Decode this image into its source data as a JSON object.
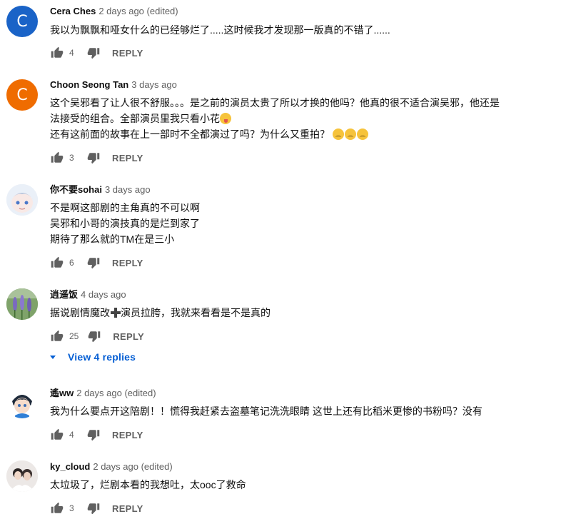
{
  "colors": {
    "link_blue": "#065fd4",
    "secondary_text": "#606060",
    "avatar_c_blue": "#1a63c7",
    "avatar_c_orange": "#ef6c00"
  },
  "comments": [
    {
      "author": "Cera Ches",
      "time": "2 days ago (edited)",
      "lines": [
        "我以为飘飘和哑女什么的已经够烂了.....这时候我才发现那一版真的不错了......"
      ],
      "likes": "4",
      "reply_label": "REPLY",
      "avatar": {
        "type": "letter",
        "letter": "C",
        "color": "#1a63c7"
      }
    },
    {
      "author": "Choon Seong Tan",
      "time": "3 days ago",
      "lines": [
        "这个吴邪看了让人很不舒服。。。是之前的演员太贵了所以才换的他吗？他真的很不适合演吴邪，他还是",
        "法接受的组合。全部演员里我只看小花",
        "还有这前面的故事在上一部时不全都演过了吗？为什么又重拍？"
      ],
      "likes": "3",
      "reply_label": "REPLY",
      "avatar": {
        "type": "letter",
        "letter": "C",
        "color": "#ef6c00"
      },
      "emojis": {
        "line2": [
          "face-with-tongue-emoji"
        ],
        "line3": [
          "sad-face-emoji",
          "sad-face-emoji",
          "sad-face-emoji"
        ]
      }
    },
    {
      "author": "你不要sohai",
      "time": "3 days ago",
      "lines": [
        "不是啊这部剧的主角真的不可以啊",
        "吴邪和小哥的演技真的是烂到家了",
        "期待了那么就的TM在是三小"
      ],
      "likes": "6",
      "reply_label": "REPLY",
      "avatar": {
        "type": "image",
        "desc": "anime-avatar"
      }
    },
    {
      "author": "逍遥饭",
      "time": "4 days ago",
      "lines_parts": [
        "据说剧情魔改",
        "演员拉胯，我就来看看是不是真的"
      ],
      "likes": "25",
      "reply_label": "REPLY",
      "view_replies": "View 4 replies",
      "avatar": {
        "type": "image",
        "desc": "lavender-avatar"
      }
    },
    {
      "author": "遙ww",
      "time": "2 days ago (edited)",
      "lines": [
        "我为什么要点开这陪剧！！慌得我赶紧去盗墓笔记洗洗眼睛 这世上还有比稻米更惨的书粉吗？没有"
      ],
      "likes": "4",
      "reply_label": "REPLY",
      "avatar": {
        "type": "image",
        "desc": "anime-boy-avatar"
      }
    },
    {
      "author": "ky_cloud",
      "time": "2 days ago (edited)",
      "lines": [
        "太垃圾了，烂剧本看的我想吐，太ooc了救命"
      ],
      "likes": "3",
      "reply_label": "REPLY",
      "avatar": {
        "type": "image",
        "desc": "photo-avatar"
      }
    }
  ]
}
